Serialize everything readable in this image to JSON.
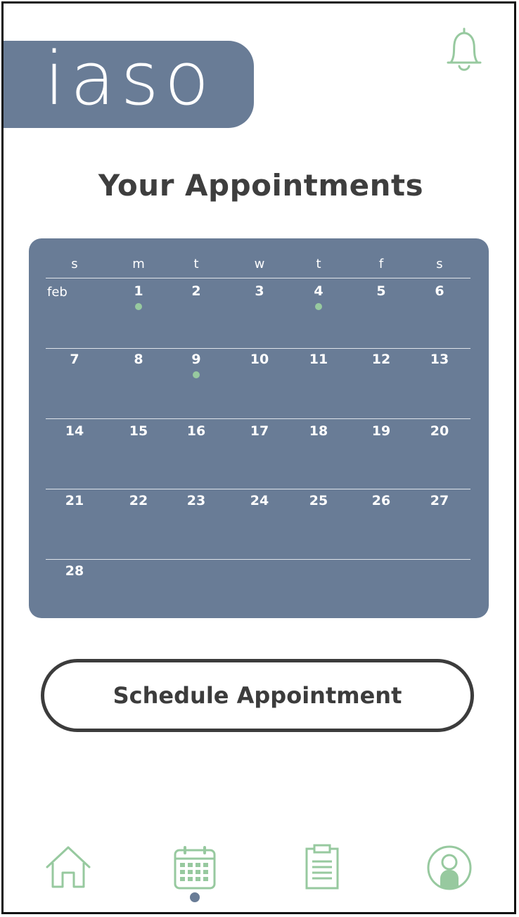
{
  "app": {
    "logo": "iaso"
  },
  "header": {
    "notifications_icon": "bell-icon"
  },
  "page": {
    "title": "Your Appointments"
  },
  "calendar": {
    "month": "feb",
    "weekdays": [
      "s",
      "m",
      "t",
      "w",
      "t",
      "f",
      "s"
    ],
    "weeks": [
      [
        "",
        "1",
        "2",
        "3",
        "4",
        "5",
        "6"
      ],
      [
        "7",
        "8",
        "9",
        "10",
        "11",
        "12",
        "13"
      ],
      [
        "14",
        "15",
        "16",
        "17",
        "18",
        "19",
        "20"
      ],
      [
        "21",
        "22",
        "23",
        "24",
        "25",
        "26",
        "27"
      ],
      [
        "28",
        "",
        "",
        "",
        "",
        "",
        ""
      ]
    ],
    "appointment_days": [
      "1",
      "4",
      "9"
    ]
  },
  "actions": {
    "schedule_label": "Schedule Appointment"
  },
  "nav": {
    "items": [
      {
        "icon": "home-icon"
      },
      {
        "icon": "calendar-icon",
        "active": true
      },
      {
        "icon": "clipboard-icon"
      },
      {
        "icon": "profile-icon"
      }
    ]
  },
  "colors": {
    "accent": "#697c96",
    "green": "#97c99f",
    "text": "#3e3e3e"
  }
}
